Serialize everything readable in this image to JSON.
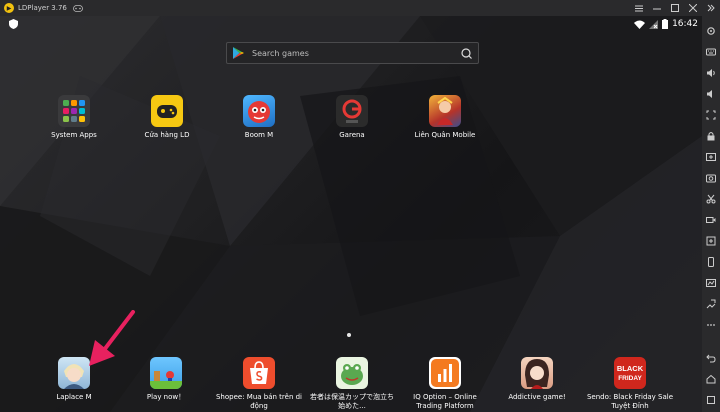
{
  "window": {
    "title": "LDPlayer 3.76"
  },
  "status_bar": {
    "time": "16:42"
  },
  "search": {
    "placeholder": "Search games"
  },
  "apps_top": [
    {
      "label": "System Apps",
      "icon": "system-apps-folder-icon"
    },
    {
      "label": "Cửa hàng LD",
      "icon": "ld-store-icon"
    },
    {
      "label": "Boom M",
      "icon": "boom-m-icon"
    },
    {
      "label": "Garena",
      "icon": "garena-icon"
    },
    {
      "label": "Liên Quân Mobile",
      "icon": "lien-quan-icon"
    }
  ],
  "apps_dock": [
    {
      "label": "Laplace M",
      "icon": "laplace-m-icon"
    },
    {
      "label": "Play now！",
      "icon": "play-now-icon"
    },
    {
      "label": "Shopee: Mua bán trên di động",
      "icon": "shopee-icon"
    },
    {
      "label": "若者は保温カップで泡立ち始めた...",
      "icon": "frog-game-icon"
    },
    {
      "label": "IQ Option – Online Trading Platform",
      "icon": "iq-option-icon"
    },
    {
      "label": "Addictive game!",
      "icon": "addictive-game-icon"
    },
    {
      "label": "Sendo: Black Friday Sale Tuyệt Đỉnh",
      "icon": "sendo-icon"
    }
  ],
  "icon_text": {
    "sendo_line1": "BLACK",
    "sendo_line2": "FRIDAY"
  },
  "colors": {
    "arrow": "#e8215f",
    "ld_store": "#f6c812",
    "shopee": "#ee4d2d",
    "iq_option": "#f47a20",
    "sendo": "#d0271d"
  },
  "sidebar": [
    {
      "icon": "settings-icon"
    },
    {
      "icon": "keyboard-icon"
    },
    {
      "icon": "volume-up-icon"
    },
    {
      "icon": "volume-down-icon"
    },
    {
      "icon": "fullscreen-icon"
    },
    {
      "icon": "lock-icon"
    },
    {
      "icon": "add-apk-icon"
    },
    {
      "icon": "screenshot-icon"
    },
    {
      "icon": "scissors-icon"
    },
    {
      "icon": "record-icon"
    },
    {
      "icon": "sync-icon"
    },
    {
      "icon": "rotate-icon"
    },
    {
      "icon": "location-icon"
    },
    {
      "icon": "shake-icon"
    },
    {
      "icon": "more-icon"
    },
    {
      "icon": "back-icon"
    },
    {
      "icon": "home-icon"
    },
    {
      "icon": "recent-apps-icon"
    }
  ]
}
